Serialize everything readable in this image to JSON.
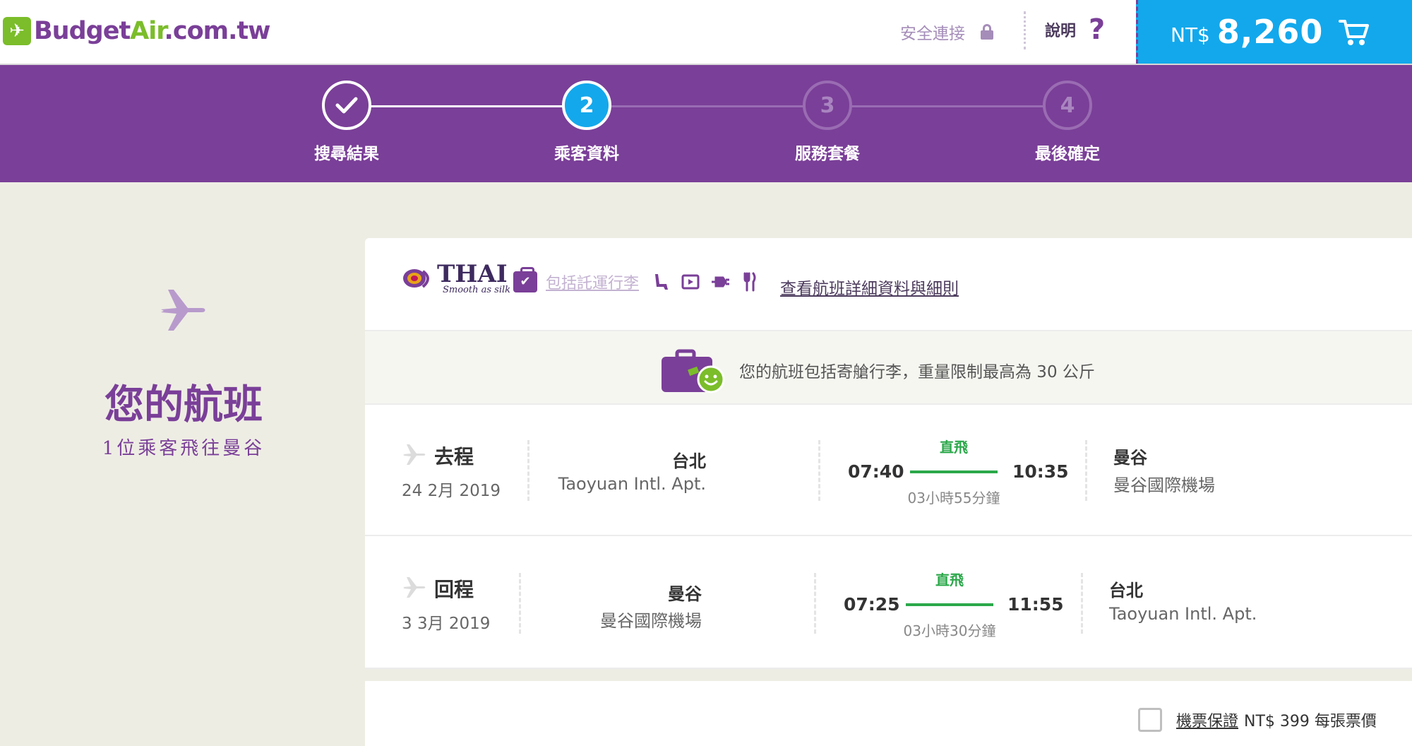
{
  "header": {
    "logo": {
      "budget": "Budget",
      "air": "Air",
      "domain": ".com.tw"
    },
    "secure_label": "安全連接",
    "help_label": "說明",
    "help_icon": "?",
    "cart": {
      "currency": "NT$",
      "amount": "8,260"
    }
  },
  "steps": [
    {
      "number": "",
      "label": "搜尋結果",
      "state": "done"
    },
    {
      "number": "2",
      "label": "乘客資料",
      "state": "active"
    },
    {
      "number": "3",
      "label": "服務套餐",
      "state": "todo"
    },
    {
      "number": "4",
      "label": "最後確定",
      "state": "todo"
    }
  ],
  "summary": {
    "title": "您的航班",
    "subtitle": "1位乘客飛往曼谷"
  },
  "airline": {
    "name": "THAI",
    "slogan": "Smooth as silk",
    "baggage_link": "包括託運行李",
    "amenities": [
      "seat-icon",
      "entertainment-icon",
      "power-plug-icon",
      "meal-icon"
    ],
    "details_link": "查看航班詳細資料與細則"
  },
  "notice": {
    "text": "您的航班包括寄艙行李，重量限制最高為 30 公斤"
  },
  "flights": [
    {
      "direction": "去程",
      "date": "24 2月 2019",
      "from_city": "台北",
      "from_airport": "Taoyuan Intl. Apt.",
      "depart_time": "07:40",
      "stops": "直飛",
      "arrive_time": "10:35",
      "duration": "03小時55分鐘",
      "to_city": "曼谷",
      "to_airport": "曼谷國際機場"
    },
    {
      "direction": "回程",
      "date": "3 3月 2019",
      "from_city": "曼谷",
      "from_airport": "曼谷國際機場",
      "depart_time": "07:25",
      "stops": "直飛",
      "arrive_time": "11:55",
      "duration": "03小時30分鐘",
      "to_city": "台北",
      "to_airport": "Taoyuan Intl. Apt."
    }
  ],
  "insurance": {
    "link": "機票保證",
    "price": "NT$ 399 每張票價"
  },
  "colors": {
    "brand_purple": "#7a3f98",
    "brand_green": "#7bbd2a",
    "cart_blue": "#13a8ec",
    "direct_green": "#2ba84a"
  }
}
